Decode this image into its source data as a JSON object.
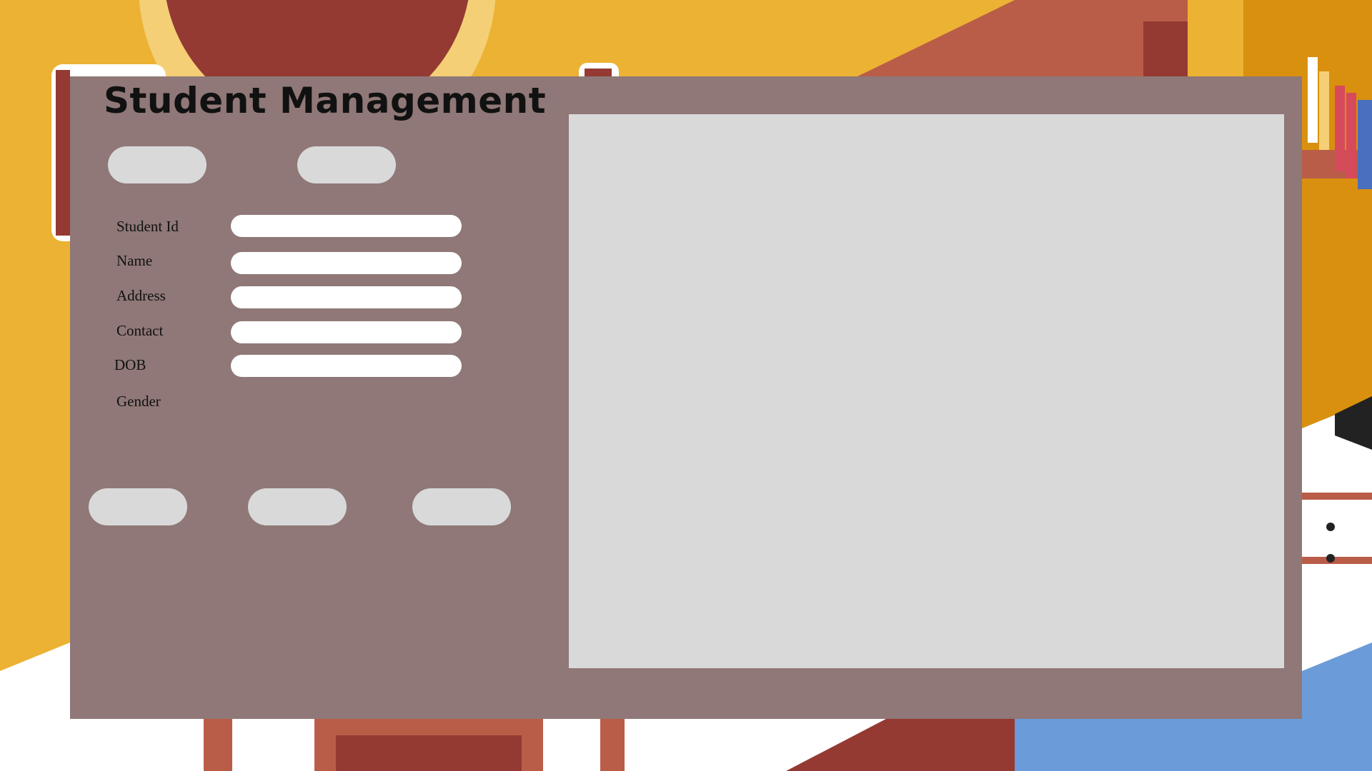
{
  "app": {
    "title": "Student Management"
  },
  "theme": {
    "panel_color": "#8f7877",
    "button_color": "#d9d9d9",
    "field_color": "#ffffff",
    "background_color": "#ecb233"
  },
  "top_buttons": [
    {
      "label": ""
    },
    {
      "label": ""
    }
  ],
  "form": {
    "fields": [
      {
        "label": "Student Id",
        "value": ""
      },
      {
        "label": "Name",
        "value": ""
      },
      {
        "label": "Address",
        "value": ""
      },
      {
        "label": "Contact",
        "value": ""
      },
      {
        "label": "DOB",
        "value": ""
      }
    ],
    "gender_label": "Gender"
  },
  "bottom_buttons": [
    {
      "label": ""
    },
    {
      "label": ""
    },
    {
      "label": ""
    }
  ],
  "table": {
    "rows": []
  }
}
